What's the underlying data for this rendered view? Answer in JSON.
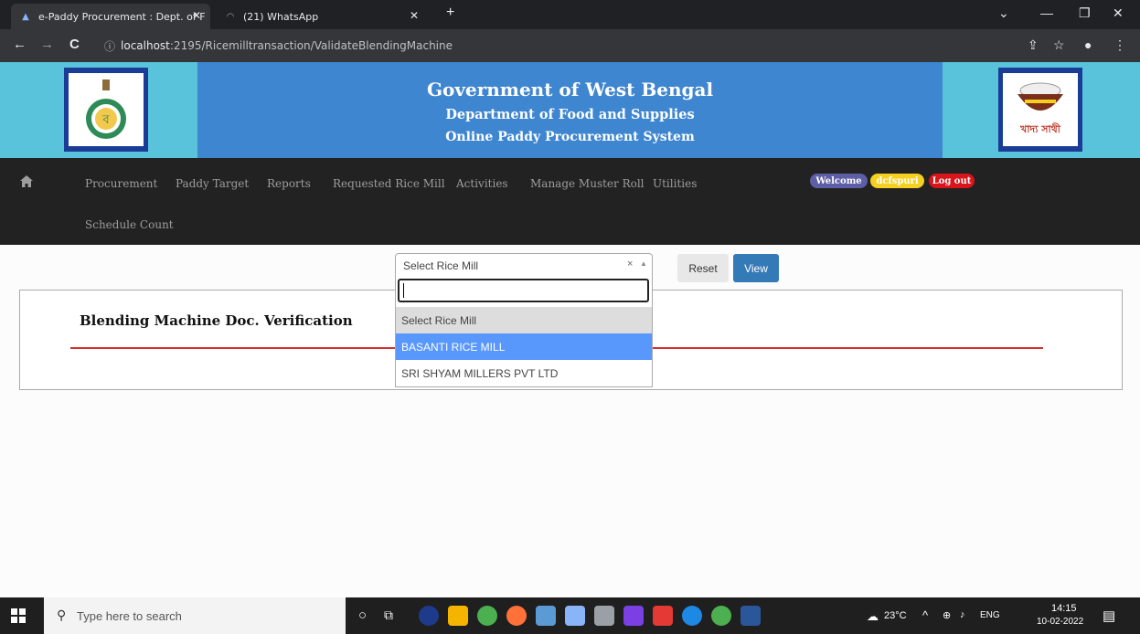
{
  "browser": {
    "tabs": [
      {
        "title": "e-Paddy Procurement : Dept. of F",
        "active": true
      },
      {
        "title": "(21) WhatsApp",
        "active": false
      }
    ],
    "new_tab": "+",
    "url_host": "localhost",
    "url_path": ":2195/Ricemilltransaction/ValidateBlendingMachine"
  },
  "header": {
    "title": "Government of West Bengal",
    "subtitle": "Department of Food and Supplies",
    "system": "Online Paddy Procurement System",
    "right_logo_text": "খাদ্য সাথী"
  },
  "nav": {
    "items": [
      "Procurement",
      "Paddy Target",
      "Reports",
      "Requested Rice Mill",
      "Activities",
      "Manage Muster Roll",
      "Utilities",
      "Schedule Count"
    ],
    "welcome": "Welcome",
    "user": "dcfspuri",
    "logout": "Log out"
  },
  "filter": {
    "selected": "Select Rice Mill",
    "clear": "×",
    "reset_label": "Reset",
    "view_label": "View"
  },
  "dropdown": {
    "options": [
      "Select Rice Mill",
      "BASANTI RICE MILL",
      "SRI SHYAM MILLERS PVT LTD"
    ]
  },
  "panel": {
    "title": "Blending Machine Doc. Verification"
  },
  "taskbar": {
    "search_placeholder": "Type here to search",
    "weather": "23°C",
    "lang": "ENG",
    "time": "14:15",
    "date": "10-02-2022"
  },
  "colors": {
    "banner_outer": "#58c3da",
    "banner_center": "#3f86d0",
    "navbar": "#222222",
    "welcome_pill": "#5e5ea6",
    "user_pill": "#f5d020",
    "logout_pill": "#d9141a",
    "view_button": "#337ab7",
    "highlight": "#5897fb"
  }
}
